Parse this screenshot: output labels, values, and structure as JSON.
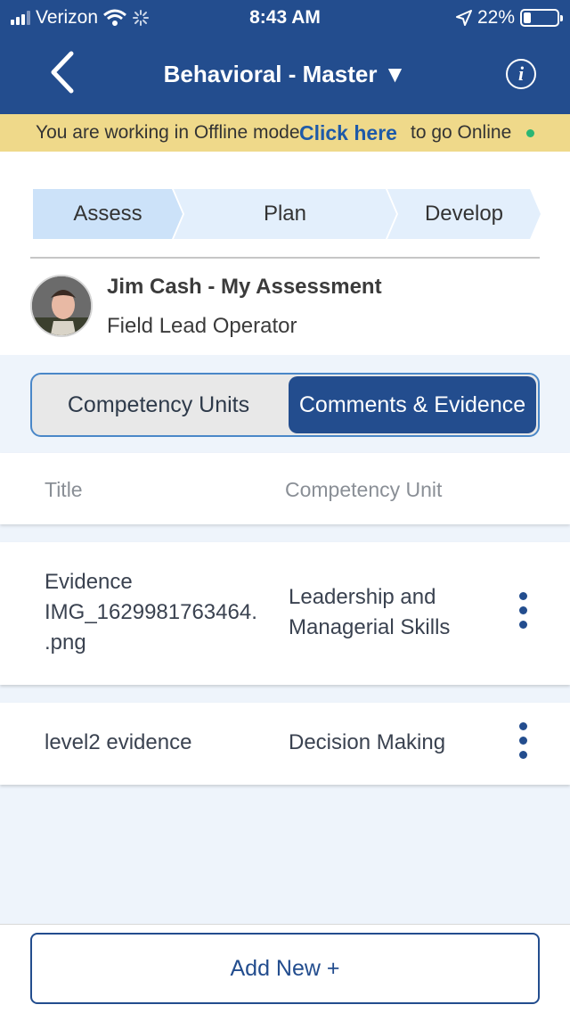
{
  "status_bar": {
    "carrier": "Verizon",
    "time": "8:43 AM",
    "battery": "22%",
    "battery_level": 0.22
  },
  "nav": {
    "title": "Behavioral - Master ▼"
  },
  "offline_banner": {
    "text_before": "You are working in Offline mode",
    "link_text": "Click here",
    "text_after": "to go Online",
    "status_color": "#2bb673"
  },
  "steps": [
    "Assess",
    "Plan",
    "Develop"
  ],
  "profile": {
    "name": "Jim Cash - My Assessment",
    "role": "Field Lead Operator"
  },
  "segments": {
    "left": "Competency Units",
    "right": "Comments & Evidence",
    "selected": "Comments & Evidence"
  },
  "table": {
    "headers": [
      "Title",
      "Competency Unit"
    ],
    "rows": [
      {
        "title": "Evidence IMG_1629981763464..png",
        "unit": "Leadership and Managerial Skills"
      },
      {
        "title": "level2 evidence",
        "unit": "Decision Making"
      }
    ]
  },
  "add_button": "Add New +",
  "colors": {
    "primary": "#234d8e",
    "banner": "#efd98a",
    "step_active": "#cce2f9"
  }
}
